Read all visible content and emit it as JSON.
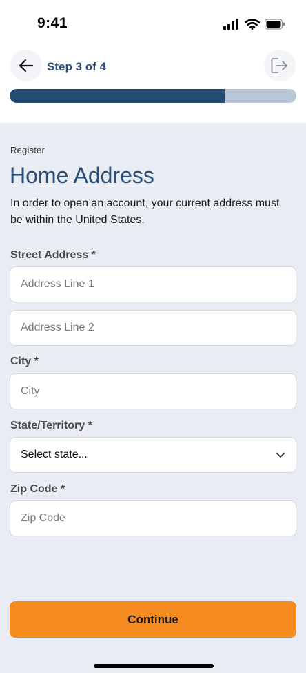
{
  "status_bar": {
    "time": "9:41"
  },
  "header": {
    "step_label": "Step 3 of 4",
    "progress_fraction": 0.75
  },
  "page": {
    "eyebrow": "Register",
    "title": "Home Address",
    "intro": "In order to open an account, your current address must be within the United States."
  },
  "form": {
    "street_label": "Street Address *",
    "address_line1_placeholder": "Address Line 1",
    "address_line2_placeholder": "Address Line 2",
    "city_label": "City *",
    "city_placeholder": "City",
    "state_label": "State/Territory *",
    "state_value": "Select state...",
    "zip_label": "Zip Code *",
    "zip_placeholder": "Zip Code"
  },
  "actions": {
    "continue_label": "Continue"
  },
  "colors": {
    "accent": "#2a4e78",
    "progress_fill": "#234b73",
    "progress_track": "#b9c8d9",
    "button": "#f58a1f",
    "background": "#e9ecf2"
  },
  "icons": {
    "back": "arrow-left-icon",
    "exit": "exit-icon",
    "select": "chevron-down-icon",
    "signal": "signal-icon",
    "wifi": "wifi-icon",
    "battery": "battery-icon"
  }
}
